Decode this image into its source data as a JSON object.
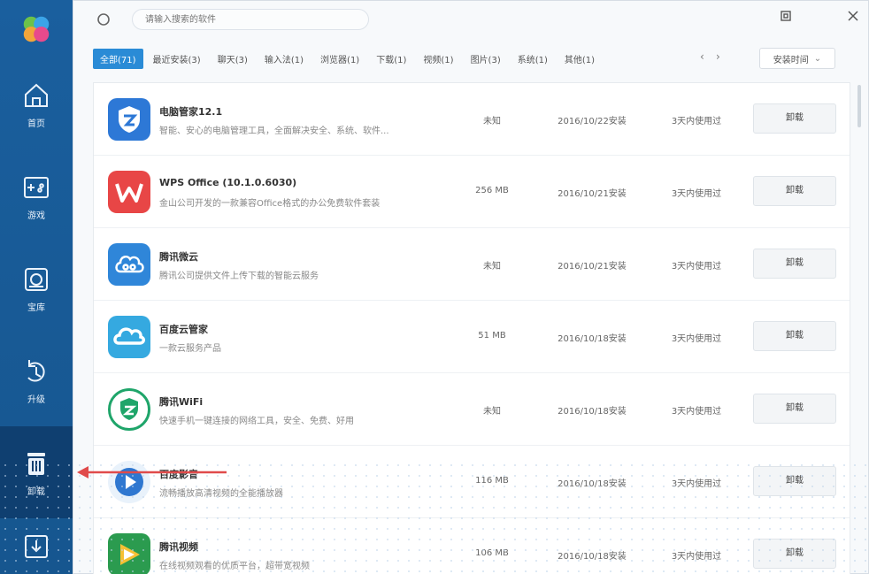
{
  "colors": {
    "sidebar": "#1a5f9e",
    "accent": "#2a8bd6",
    "annotation_arrow": "#e04b4b"
  },
  "sidebar": {
    "items": [
      {
        "label": "首页",
        "icon": "home-icon"
      },
      {
        "label": "游戏",
        "icon": "game-icon"
      },
      {
        "label": "宝库",
        "icon": "treasure-icon"
      },
      {
        "label": "升级",
        "icon": "upgrade-icon"
      },
      {
        "label": "卸载",
        "icon": "trash-icon"
      },
      {
        "label": "",
        "icon": "download-icon"
      }
    ]
  },
  "search": {
    "placeholder": "请输入搜索的软件"
  },
  "tabs": [
    "全部(71)",
    "最近安装(3)",
    "聊天(3)",
    "输入法(1)",
    "浏览器(1)",
    "下载(1)",
    "视频(1)",
    "图片(3)",
    "系统(1)",
    "其他(1)"
  ],
  "sort": {
    "label": "安装时间",
    "chevron": "⌄"
  },
  "apps": [
    {
      "name": "电脑管家12.1",
      "desc": "智能、安心的电脑管理工具，全面解决安全、系统、软件...",
      "size": "未知",
      "date": "2016/10/22安装",
      "usage": "3天内使用过",
      "action": "卸载",
      "icon_bg": "#2d78d6",
      "icon": "shield-app-icon"
    },
    {
      "name": "WPS Office (10.1.0.6030)",
      "desc": "金山公司开发的一款兼容Office格式的办公免费软件套装",
      "size": "256 MB",
      "date": "2016/10/21安装",
      "usage": "3天内使用过",
      "action": "卸载",
      "icon_bg": "#e84646",
      "icon": "wps-icon"
    },
    {
      "name": "腾讯微云",
      "desc": "腾讯公司提供文件上传下载的智能云服务",
      "size": "未知",
      "date": "2016/10/21安装",
      "usage": "3天内使用过",
      "action": "卸载",
      "icon_bg": "#2f86d9",
      "icon": "cloud-icon"
    },
    {
      "name": "百度云管家",
      "desc": "一款云服务产品",
      "size": "51 MB",
      "date": "2016/10/18安装",
      "usage": "3天内使用过",
      "action": "卸载",
      "icon_bg": "#35a9e0",
      "icon": "baidu-cloud-icon"
    },
    {
      "name": "腾讯WiFi",
      "desc": "快速手机一键连接的网络工具，安全、免费、好用",
      "size": "未知",
      "date": "2016/10/18安装",
      "usage": "3天内使用过",
      "action": "卸载",
      "icon_bg": "#1fa56a",
      "icon": "wifi-app-icon"
    },
    {
      "name": "百度影音",
      "desc": "流畅播放高清视频的全能播放器",
      "size": "116 MB",
      "date": "2016/10/18安装",
      "usage": "3天内使用过",
      "action": "卸载",
      "icon_bg": "#2f77d0",
      "icon": "player-icon"
    },
    {
      "name": "腾讯视频",
      "desc": "在线视频观看的优质平台，超带宽视频",
      "size": "106 MB",
      "date": "2016/10/18安装",
      "usage": "3天内使用过",
      "action": "卸载",
      "icon_bg": "#2b9b4f",
      "icon": "video-icon"
    }
  ]
}
